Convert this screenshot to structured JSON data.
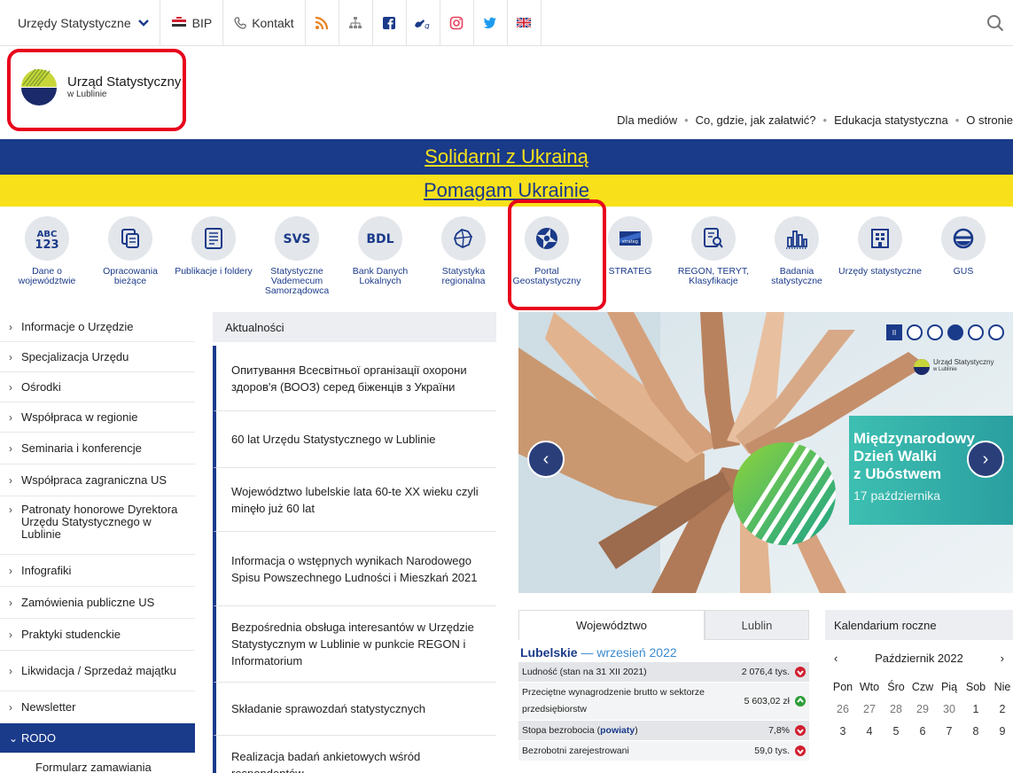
{
  "topbar": {
    "offices_label": "Urzędy Statystyczne",
    "bip_label": "BIP",
    "contact_label": "Kontakt",
    "icons": [
      "rss-icon",
      "sitemap-icon",
      "facebook-icon",
      "sign-language-icon",
      "instagram-icon",
      "twitter-icon",
      "uk-flag-icon"
    ]
  },
  "header": {
    "logo_line1": "Urząd Statystyczny",
    "logo_line2": "w Lublinie",
    "nav": [
      "Dla mediów",
      "Co, gdzie, jak załatwić?",
      "Edukacja statystyczna",
      "O stronie"
    ]
  },
  "banners": {
    "blue_text": "Solidarni z Ukrainą",
    "yellow_text": "Pomagam Ukrainie",
    "blue_color": "#1a3a8a",
    "yellow_color": "#f8e11a"
  },
  "tiles": [
    {
      "label": "Dane o województwie",
      "icon_text": "ABC 123",
      "icon": "abc-123-icon"
    },
    {
      "label": "Opracowania bieżące",
      "icon": "documents-icon"
    },
    {
      "label": "Publikacje i foldery",
      "icon": "publication-icon"
    },
    {
      "label": "Statystyczne Vademecum Samorządowca",
      "icon_text": "SVS",
      "icon": "svs-icon"
    },
    {
      "label": "Bank Danych Lokalnych",
      "icon_text": "BDL",
      "icon": "bdl-icon"
    },
    {
      "label": "Statystyka regionalna",
      "icon": "region-map-icon"
    },
    {
      "label": "Portal Geostatystyczny",
      "icon": "geostat-icon"
    },
    {
      "label": "STRATEG",
      "icon_text": "strateg",
      "icon": "strateg-icon"
    },
    {
      "label": "REGON, TERYT, Klasyfikacje",
      "icon": "regon-search-icon"
    },
    {
      "label": "Badania statystyczne",
      "icon": "bar-chart-icon"
    },
    {
      "label": "Urzędy statystyczne",
      "icon": "building-icon"
    },
    {
      "label": "GUS",
      "icon": "gus-icon"
    }
  ],
  "sidebar": {
    "items": [
      "Informacje o Urzędzie",
      "Specjalizacja Urzędu",
      "Ośrodki",
      "Współpraca w regionie",
      "Seminaria i konferencje",
      "Współpraca zagraniczna US",
      "Patronaty honorowe Dyrektora Urzędu Statystycznego w Lublinie",
      "Infografiki",
      "Zamówienia publiczne US",
      "Praktyki studenckie",
      "Likwidacja / Sprzedaż majątku",
      "Newsletter",
      "RODO",
      "Formularz zamawiania"
    ]
  },
  "news": {
    "header": "Aktualności",
    "items": [
      "Опитування Всесвітньої організації охорони здоров'я (ВООЗ) серед біженців з України",
      "60 lat Urzędu Statystycznego w Lublinie",
      "Województwo lubelskie lata 60-te XX wieku czyli minęło już 60 lat",
      "Informacja o wstępnych wynikach Narodowego Spisu Powszechnego Ludności i Mieszkań 2021",
      "Bezpośrednia obsługa interesantów w Urzędzie Statystycznym w Lublinie w punkcie REGON i Informatorium",
      "Składanie sprawozdań statystycznych",
      "Realizacja badań ankietowych wśród respondentów"
    ]
  },
  "slider": {
    "pause_label": "II",
    "slide_count": 5,
    "active_index": 3,
    "logo_line1": "Urząd Statystyczny",
    "logo_line2": "w Lublinie",
    "title_line1": "Międzynarodowy",
    "title_line2": "Dzień Walki",
    "title_line3": "z Ubóstwem",
    "subtitle": "17 października"
  },
  "stats": {
    "tab_active": "Województwo",
    "tab_inactive": "Lublin",
    "region": "Lubelskie",
    "dash": " — ",
    "period": "wrzesień 2022",
    "rows": [
      {
        "name": "Ludność (stan na 31 XII 2021)",
        "value": "2 076,4 tys.",
        "trend": "down"
      },
      {
        "name": "Przeciętne wynagrodzenie brutto w sektorze przedsiębiorstw",
        "value": "5 603,02 zł",
        "trend": "up"
      },
      {
        "name_pre": "Stopa bezrobocia (",
        "name_link": "powiaty",
        "name_post": ")",
        "value": "7,8%",
        "trend": "down"
      },
      {
        "name": "Bezrobotni zarejestrowani",
        "value": "59,0 tys.",
        "trend": "down"
      }
    ],
    "up_color": "#2e9e3a",
    "down_color": "#d01e2e"
  },
  "calendar": {
    "header": "Kalendarium roczne",
    "prev": "‹",
    "next": "›",
    "month": "Październik 2022",
    "weekdays": [
      "Pon",
      "Wto",
      "Śro",
      "Czw",
      "Pią",
      "Sob",
      "Nie"
    ],
    "week1": [
      "26",
      "27",
      "28",
      "29",
      "30",
      "1",
      "2"
    ],
    "week2": [
      "3",
      "4",
      "5",
      "6",
      "7",
      "8",
      "9"
    ]
  }
}
